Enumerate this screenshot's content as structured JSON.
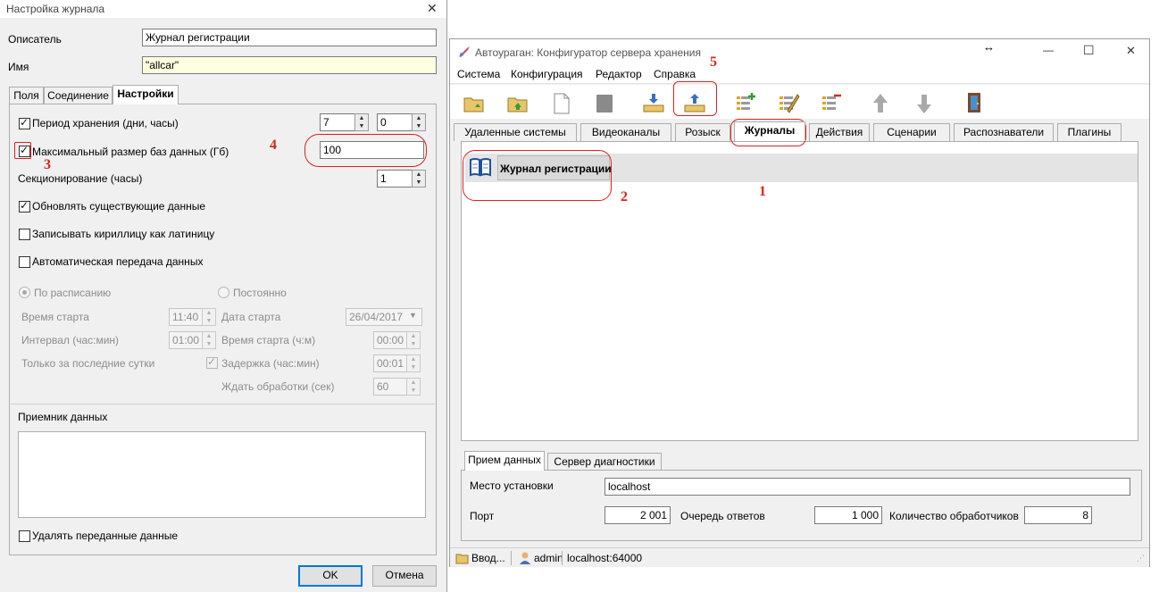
{
  "dialog": {
    "title": "Настройка журнала",
    "close_glyph": "✕",
    "descriptor_label": "Описатель",
    "descriptor_value": "Журнал регистрации",
    "name_label": "Имя",
    "name_value": "\"allcar\"",
    "tabs": [
      {
        "label": "Поля"
      },
      {
        "label": "Соединение"
      },
      {
        "label": "Настройки"
      }
    ],
    "settings": {
      "retention_label": "Период хранения (дни, часы)",
      "retention_days": "7",
      "retention_hours": "0",
      "max_db_label": "Максимальный размер баз данных (Гб)",
      "max_db_value": "100",
      "sectioning_label": "Секционирование (часы)",
      "sectioning_value": "1",
      "update_label": "Обновлять существующие данные",
      "cyrillic_label": "Записывать кириллицу как латиницу",
      "auto_transfer_label": "Автоматическая передача данных",
      "schedule_label": "По расписанию",
      "constant_label": "Постоянно",
      "start_time_label": "Время старта",
      "start_time_value": "11:40",
      "start_date_label": "Дата старта",
      "start_date_value": "26/04/2017",
      "interval_label": "Интервал (час:мин)",
      "interval_value": "01:00",
      "start_time_hm_label": "Время старта (ч:м)",
      "start_time_hm_value": "00:00",
      "last_day_label": "Только за последние сутки",
      "delay_label": "Задержка (час:мин)",
      "delay_value": "00:01",
      "wait_label": "Ждать обработки (сек)",
      "wait_value": "60",
      "receiver_label": "Приемник данных",
      "delete_label": "Удалять переданные данные"
    },
    "ok_label": "OK",
    "cancel_label": "Отмена"
  },
  "app": {
    "title": "Автоураган: Конфигуратор сервера хранения",
    "resize_glyph": "↔",
    "minimize_glyph": "—",
    "maximize_glyph": "☐",
    "close_glyph": "✕",
    "menu": [
      {
        "label": "Система"
      },
      {
        "label": "Конфигурация"
      },
      {
        "label": "Редактор"
      },
      {
        "label": "Справка"
      }
    ],
    "tabs": [
      {
        "label": "Удаленные системы"
      },
      {
        "label": "Видеоканалы"
      },
      {
        "label": "Розыск"
      },
      {
        "label": "Журналы"
      },
      {
        "label": "Действия"
      },
      {
        "label": "Сценарии"
      },
      {
        "label": "Распознаватели"
      },
      {
        "label": "Плагины"
      }
    ],
    "journal_item": "Журнал регистрации",
    "bottom_tabs": [
      {
        "label": "Прием данных"
      },
      {
        "label": "Сервер диагностики"
      }
    ],
    "location_label": "Место установки",
    "location_value": "localhost",
    "port_label": "Порт",
    "port_value": "2 001",
    "queue_label": "Очередь ответов",
    "queue_value": "1 000",
    "handlers_label": "Количество обработчиков",
    "handlers_value": "8",
    "status": {
      "input": "Ввод...",
      "user": "admin",
      "host": "localhost:64000"
    }
  },
  "annotations": [
    "1",
    "2",
    "3",
    "4",
    "5"
  ],
  "colors": {
    "annotation_red": "#e0201d",
    "name_field_bg": "#ffffe1",
    "accent_blue": "#0078d7"
  }
}
